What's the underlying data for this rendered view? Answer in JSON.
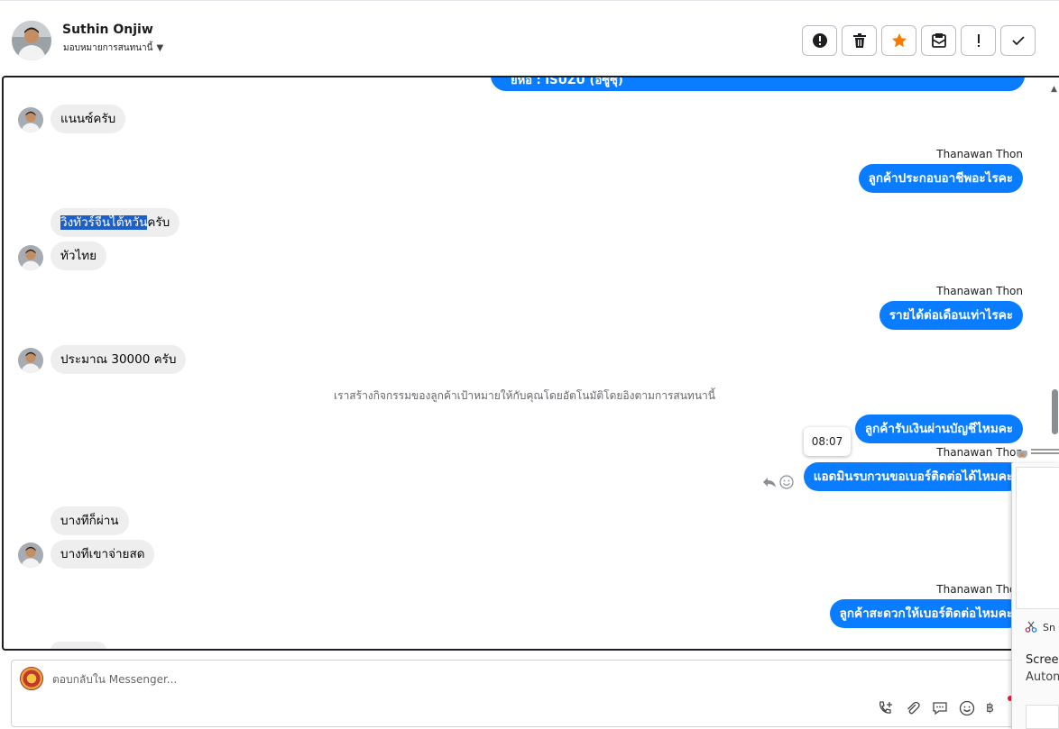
{
  "header": {
    "contact_name": "Suthin Onjiw",
    "assign_label": "มอบหมายการสนทนานี้",
    "toolbar": [
      {
        "name": "alert-button",
        "icon": "exclamation-circle-icon"
      },
      {
        "name": "delete-button",
        "icon": "trash-icon"
      },
      {
        "name": "star-button",
        "icon": "star-icon",
        "color": "#f57c00"
      },
      {
        "name": "spam-button",
        "icon": "mail-blocked-icon"
      },
      {
        "name": "priority-button",
        "icon": "exclamation-icon"
      },
      {
        "name": "done-button",
        "icon": "check-icon"
      }
    ]
  },
  "conversation": {
    "top_cut_message": "ยี่ห้อ : ISUZU (อีซูซุ)",
    "messages": [
      {
        "dir": "in",
        "text": "แนนซ์ครับ"
      },
      {
        "dir": "out",
        "sender": "Thanawan Thon",
        "text": "ลูกค้าประกอบอาชีพอะไรคะ"
      },
      {
        "dir": "in",
        "text_highlight": "วิ่งทัวร์จีนไต้หวัน",
        "text_rest": "ครับ"
      },
      {
        "dir": "in",
        "text": "ทัวไทย"
      },
      {
        "dir": "out",
        "sender": "Thanawan Thon",
        "text": "รายได้ต่อเดือนเท่าไรคะ"
      },
      {
        "dir": "in",
        "text": "ประมาณ 30000 ครับ"
      },
      {
        "dir": "system",
        "text": "เราสร้างกิจกรรมของลูกค้าเป้าหมายให้กับคุณโดยอัตโนมัติโดยอิงตามการสนทนานี้"
      },
      {
        "dir": "out",
        "text": "ลูกค้ารับเงินผ่านบัญชีไหมคะ"
      },
      {
        "dir": "out",
        "sender": "Thanawan Thon",
        "text": "แอดมินรบกวนขอเบอร์ติดต่อได้ไหมคะ"
      },
      {
        "dir": "in",
        "text": "บางทีก็ผ่าน"
      },
      {
        "dir": "in",
        "text": "บางทีเขาจ่ายสด"
      },
      {
        "dir": "out",
        "sender": "Thanawan Thon",
        "text": "ลูกค้าสะดวกให้เบอร์ติดต่อไหมคะ"
      }
    ],
    "tooltip_time": "08:07"
  },
  "reply": {
    "placeholder": "ตอบกลับใน Messenger...",
    "icons": [
      "phone-add-icon",
      "paperclip-icon",
      "chat-template-icon",
      "emoji-icon",
      "baht-icon"
    ],
    "baht_symbol": "฿"
  },
  "overlay": {
    "app_label": "Sn",
    "title": "Screen",
    "subtitle": "Autom"
  }
}
